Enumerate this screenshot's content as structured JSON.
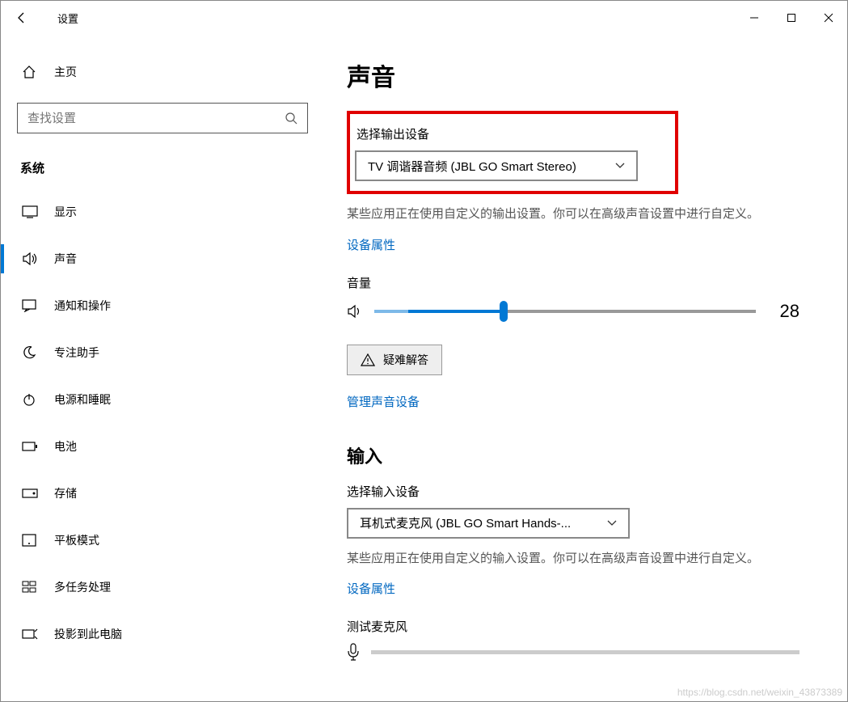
{
  "titlebar": {
    "title": "设置"
  },
  "sidebar": {
    "home": "主页",
    "search_placeholder": "查找设置",
    "group": "系统",
    "items": [
      {
        "icon": "display",
        "label": "显示"
      },
      {
        "icon": "sound",
        "label": "声音"
      },
      {
        "icon": "notify",
        "label": "通知和操作"
      },
      {
        "icon": "focus",
        "label": "专注助手"
      },
      {
        "icon": "power",
        "label": "电源和睡眠"
      },
      {
        "icon": "battery",
        "label": "电池"
      },
      {
        "icon": "storage",
        "label": "存储"
      },
      {
        "icon": "tablet",
        "label": "平板模式"
      },
      {
        "icon": "multitask",
        "label": "多任务处理"
      },
      {
        "icon": "project",
        "label": "投影到此电脑"
      }
    ],
    "active_index": 1
  },
  "main": {
    "page_title": "声音",
    "output": {
      "section_label": "选择输出设备",
      "device": "TV 调谐器音频 (JBL GO Smart Stereo)",
      "desc": "某些应用正在使用自定义的输出设置。你可以在高级声音设置中进行自定义。",
      "device_props": "设备属性",
      "volume_label": "音量",
      "volume_value": "28",
      "volume_percent": 28,
      "troubleshoot": "疑难解答",
      "manage": "管理声音设备"
    },
    "input": {
      "heading": "输入",
      "section_label": "选择输入设备",
      "device": "耳机式麦克风 (JBL GO Smart Hands-...",
      "desc": "某些应用正在使用自定义的输入设置。你可以在高级声音设置中进行自定义。",
      "device_props": "设备属性",
      "test_mic": "测试麦克风"
    }
  },
  "watermark": "https://blog.csdn.net/weixin_43873389"
}
